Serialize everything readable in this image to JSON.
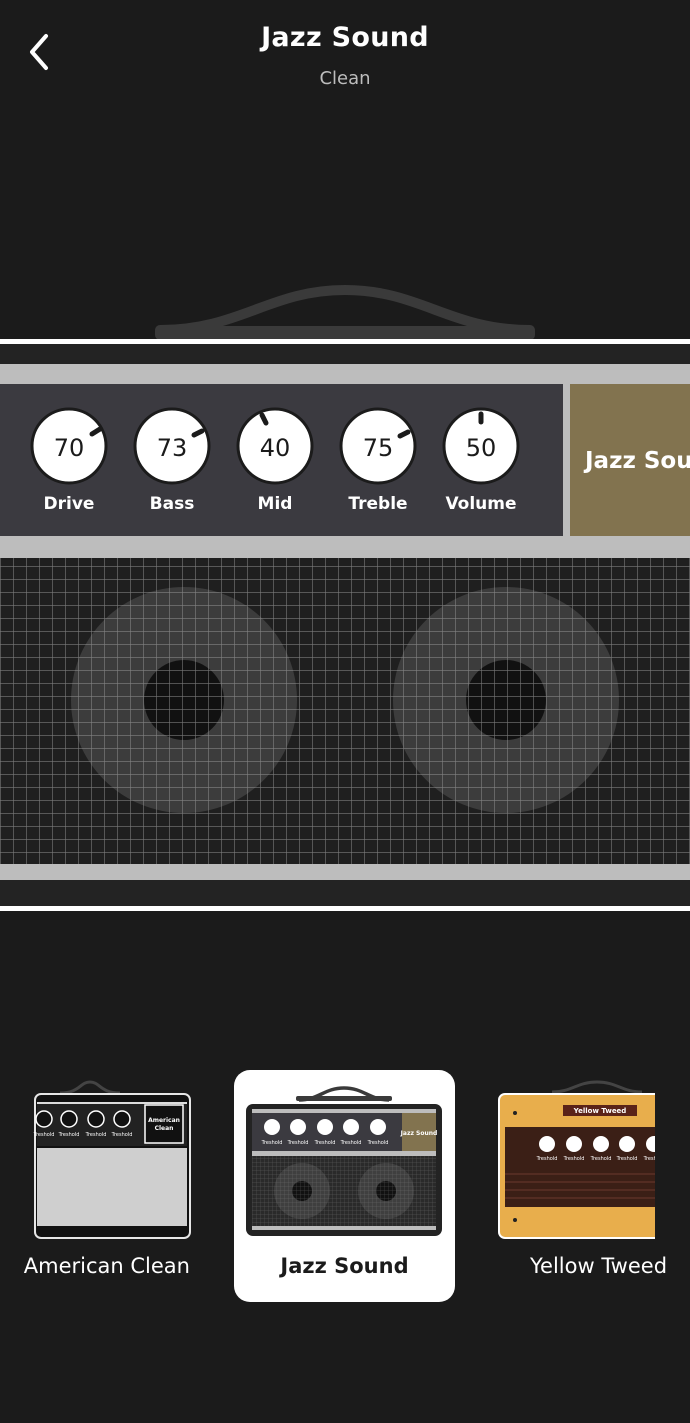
{
  "header": {
    "title": "Jazz Sound",
    "subtitle": "Clean"
  },
  "amp": {
    "brand_label": "Jazz Sound",
    "panel_color": "#3b3a40",
    "nameplate_color": "#82734f",
    "knobs": [
      {
        "label": "Drive",
        "value": "70"
      },
      {
        "label": "Bass",
        "value": "73"
      },
      {
        "label": "Mid",
        "value": "40"
      },
      {
        "label": "Treble",
        "value": "75"
      },
      {
        "label": "Volume",
        "value": "50"
      }
    ]
  },
  "carousel": {
    "items": [
      {
        "label": "American Clean",
        "thumb_plate": "American Clean",
        "knob_label": "Treshold"
      },
      {
        "label": "Jazz Sound",
        "thumb_plate": "Jazz Sound",
        "knob_label": "Treshold",
        "selected": true
      },
      {
        "label": "Yellow Tweed",
        "thumb_plate": "Yellow Tweed",
        "knob_label": "Treshold"
      }
    ]
  }
}
